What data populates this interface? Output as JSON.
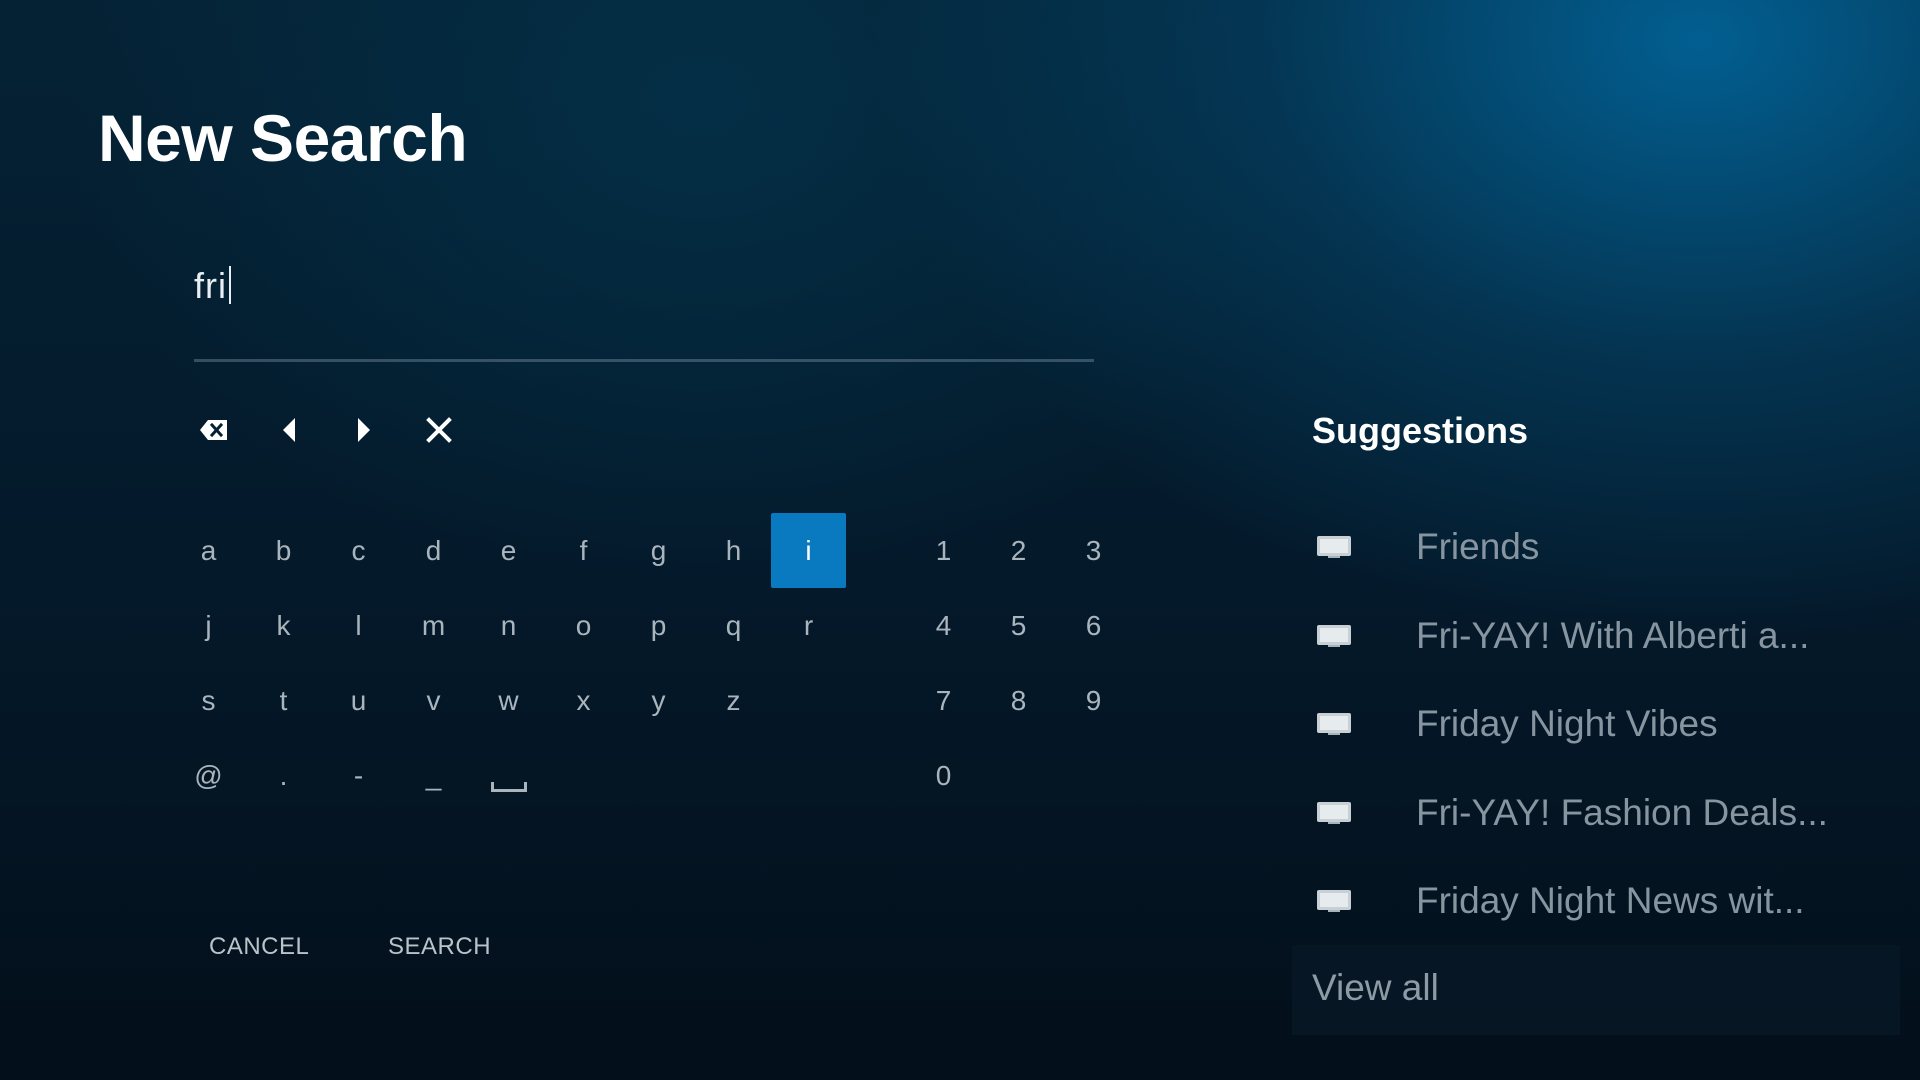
{
  "page": {
    "title": "New Search"
  },
  "search": {
    "value": "fri"
  },
  "edit_controls": {
    "backspace_icon": "backspace-icon",
    "left_icon": "arrow-left-icon",
    "right_icon": "arrow-right-icon",
    "clear_icon": "clear-icon"
  },
  "keyboard": {
    "letter_rows": [
      [
        "a",
        "b",
        "c",
        "d",
        "e",
        "f",
        "g",
        "h",
        "i"
      ],
      [
        "j",
        "k",
        "l",
        "m",
        "n",
        "o",
        "p",
        "q",
        "r"
      ],
      [
        "s",
        "t",
        "u",
        "v",
        "w",
        "x",
        "y",
        "z"
      ],
      [
        "@",
        ".",
        "-",
        "_"
      ]
    ],
    "space_key_icon": "space-icon",
    "number_rows": [
      [
        "1",
        "2",
        "3"
      ],
      [
        "4",
        "5",
        "6"
      ],
      [
        "7",
        "8",
        "9"
      ],
      [
        "0"
      ]
    ],
    "focused_key": "i",
    "focus_color": "#0a7ac0"
  },
  "actions": {
    "cancel_label": "CANCEL",
    "search_label": "SEARCH"
  },
  "suggestions": {
    "heading": "Suggestions",
    "items": [
      {
        "label": "Friends",
        "icon": "tv-icon"
      },
      {
        "label": "Fri-YAY! With Alberti a...",
        "icon": "tv-icon"
      },
      {
        "label": "Friday Night Vibes",
        "icon": "tv-icon"
      },
      {
        "label": "Fri-YAY! Fashion Deals...",
        "icon": "tv-icon"
      },
      {
        "label": "Friday Night News wit...",
        "icon": "tv-icon"
      }
    ],
    "view_all_label": "View all"
  }
}
